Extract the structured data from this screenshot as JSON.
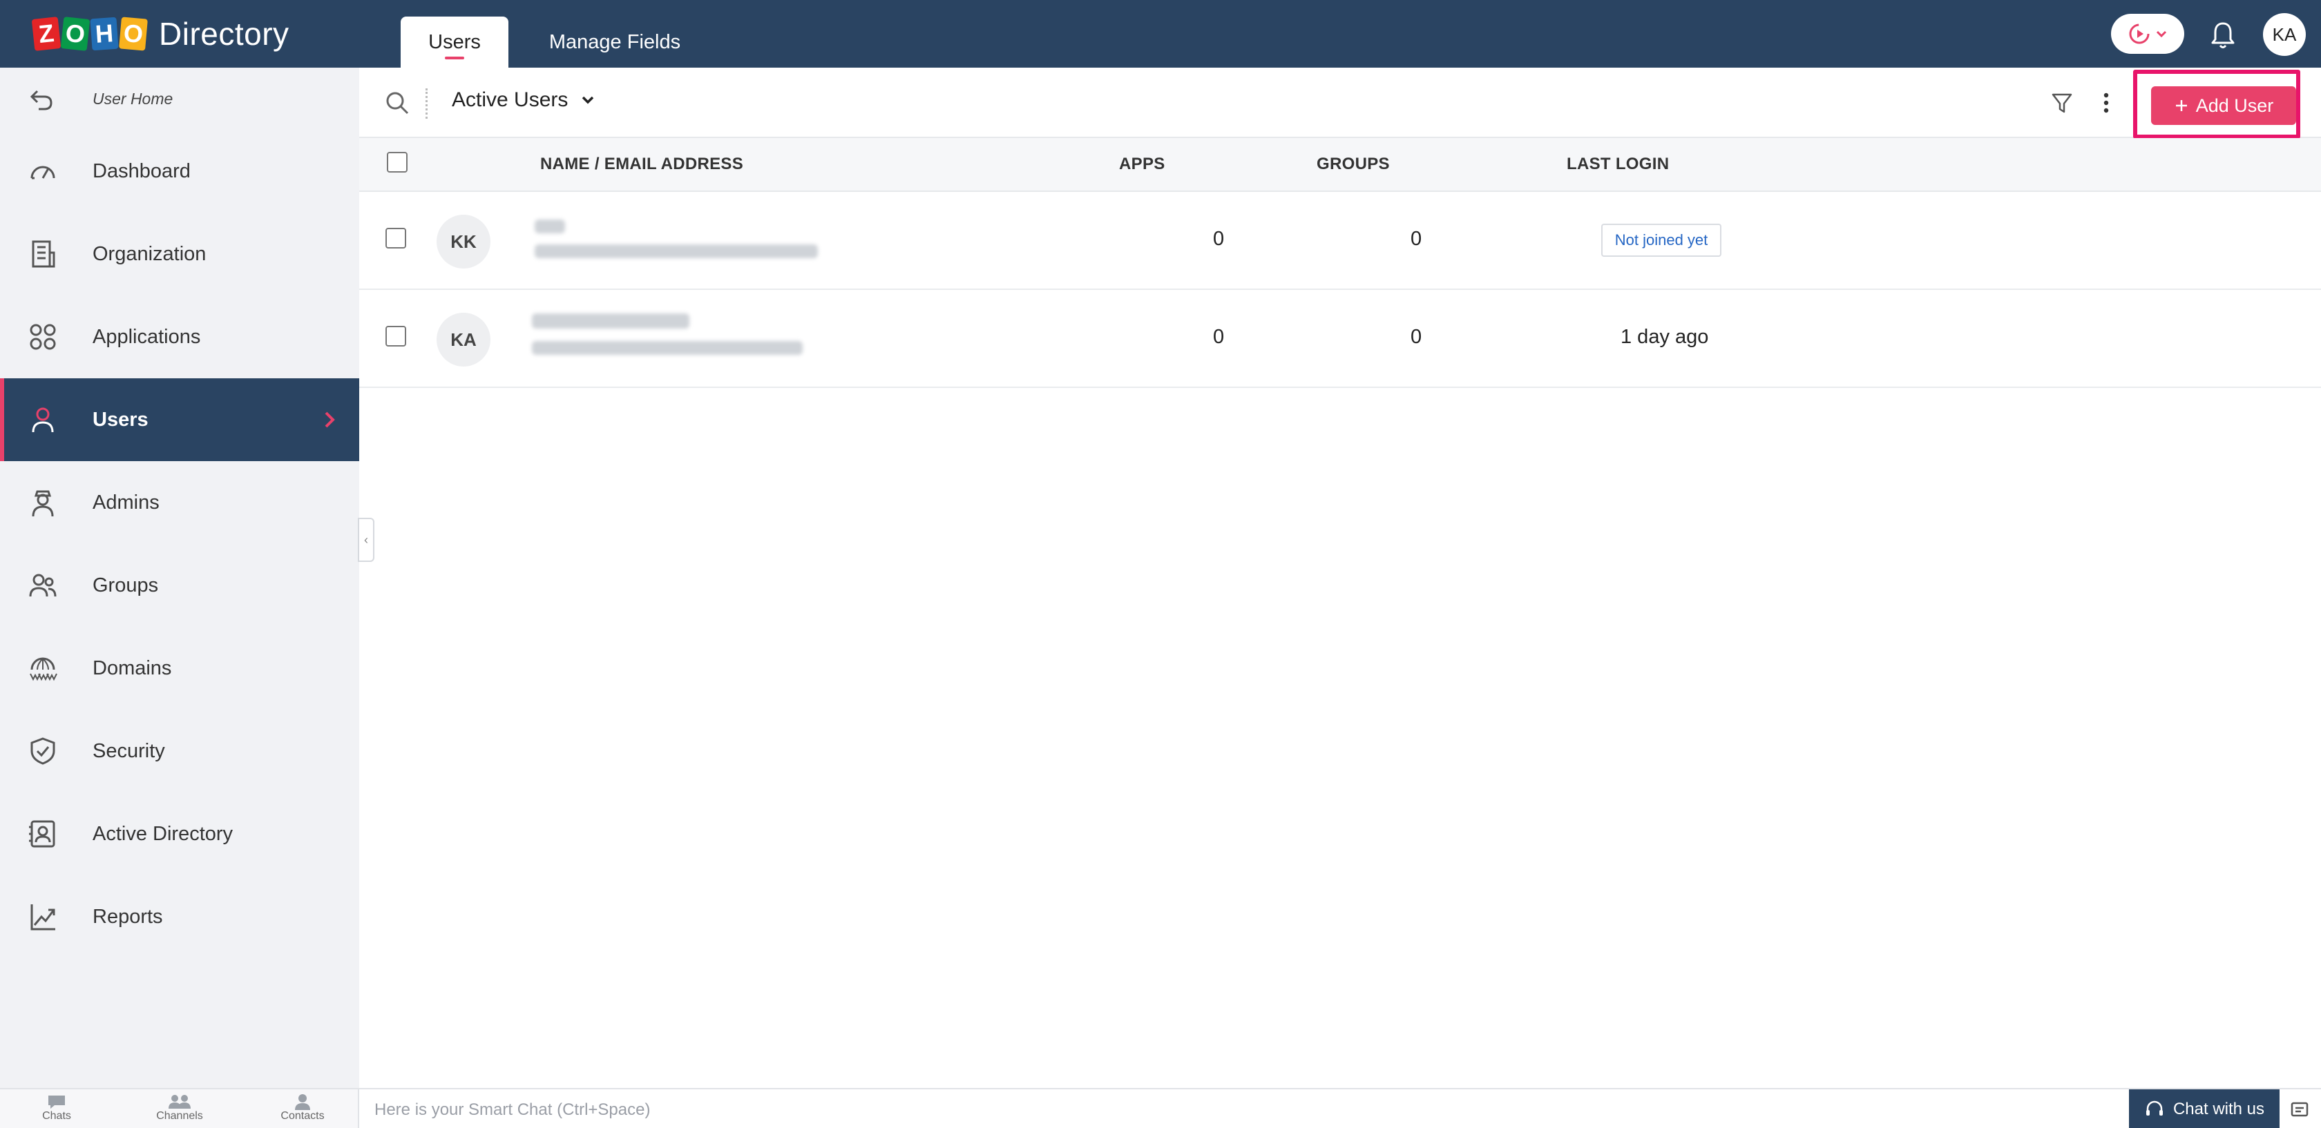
{
  "app": {
    "logo_letters": [
      "Z",
      "O",
      "H",
      "O"
    ],
    "title": "Directory"
  },
  "header": {
    "tabs": [
      {
        "label": "Users",
        "active": true
      },
      {
        "label": "Manage Fields",
        "active": false
      }
    ],
    "user_initials": "KA"
  },
  "sidebar": {
    "home_label": "User Home",
    "items": [
      {
        "label": "Dashboard",
        "icon": "dashboard-icon"
      },
      {
        "label": "Organization",
        "icon": "organization-icon"
      },
      {
        "label": "Applications",
        "icon": "applications-icon"
      },
      {
        "label": "Users",
        "icon": "users-icon",
        "active": true
      },
      {
        "label": "Admins",
        "icon": "admins-icon"
      },
      {
        "label": "Groups",
        "icon": "groups-icon"
      },
      {
        "label": "Domains",
        "icon": "domains-icon"
      },
      {
        "label": "Security",
        "icon": "security-icon"
      },
      {
        "label": "Active Directory",
        "icon": "active-directory-icon"
      },
      {
        "label": "Reports",
        "icon": "reports-icon"
      }
    ]
  },
  "toolbar": {
    "view_label": "Active Users",
    "add_user_label": "Add User"
  },
  "table": {
    "columns": [
      "NAME / EMAIL ADDRESS",
      "APPS",
      "GROUPS",
      "LAST LOGIN"
    ],
    "rows": [
      {
        "initials": "KK",
        "apps": "0",
        "groups": "0",
        "last_login": "Not joined yet",
        "last_login_badge": true
      },
      {
        "initials": "KA",
        "apps": "0",
        "groups": "0",
        "last_login": "1 day ago",
        "last_login_badge": false
      }
    ]
  },
  "bottombar": {
    "tabs": [
      "Chats",
      "Channels",
      "Contacts"
    ],
    "smart_chat_placeholder": "Here is your Smart Chat (Ctrl+Space)",
    "chat_with_us": "Chat with us"
  },
  "colors": {
    "header_bg": "#2a4462",
    "accent": "#e8416a",
    "highlight_border": "#e8146a",
    "sidebar_bg": "#f1f2f5",
    "badge_text": "#2566c4"
  }
}
